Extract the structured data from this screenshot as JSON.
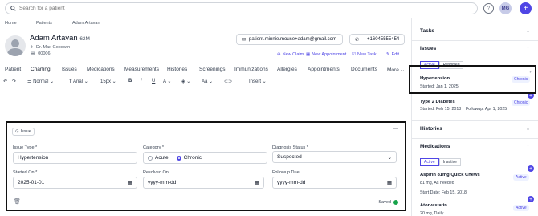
{
  "search": {
    "placeholder": "Search for a patient"
  },
  "user": {
    "initials": "MG"
  },
  "breadcrumbs": [
    "Home",
    "Patients",
    "Adam Artavan"
  ],
  "patient": {
    "name": "Adam Artavan",
    "age": "62M",
    "doctor": "Dr. Max Goodwin",
    "id": "00006",
    "email": "patient.minnie.mouse+adam@gmail.com",
    "phone": "+16045555454"
  },
  "actions": [
    "New Claim",
    "New Appointment",
    "New Task",
    "Edit"
  ],
  "tabs": [
    "Patient",
    "Charting",
    "Issues",
    "Medications",
    "Measurements",
    "Histories",
    "Screenings",
    "Immunizations",
    "Allergies",
    "Appointments",
    "Documents",
    "More"
  ],
  "toolbar": {
    "style": "Normal",
    "font": "Arial",
    "size": "15px",
    "insert": "Insert"
  },
  "issue": {
    "header": "Issue",
    "type_label": "Issue Type *",
    "type_value": "Hypertension",
    "category_label": "Category *",
    "category_options": [
      "Acute",
      "Chronic"
    ],
    "diagnosis_label": "Diagnosis Status *",
    "diagnosis_value": "Suspected",
    "started_label": "Started On *",
    "started_value": "2025-01-01",
    "resolved_label": "Resolved On",
    "resolved_placeholder": "yyyy-mm-dd",
    "followup_label": "Followup Due",
    "followup_placeholder": "yyyy-mm-dd",
    "saved": "Saved"
  },
  "sidebar": {
    "tasks": "Tasks",
    "issues": "Issues",
    "issue_tabs": [
      "Active",
      "Resolved"
    ],
    "issue_items": [
      {
        "title": "Hypertension",
        "sub": "Started: Jan 1, 2025",
        "badge": "Chronic"
      },
      {
        "title": "Type 2 Diabetes",
        "sub": "Started: Feb 15, 2018",
        "sub2": "Followup: Apr 1, 2025",
        "badge": "Chronic"
      }
    ],
    "histories": "Histories",
    "medications": "Medications",
    "med_tabs": [
      "Active",
      "Inactive"
    ],
    "med_items": [
      {
        "title": "Aspirin 81mg Quick Chews",
        "sub": "81 mg, As needed",
        "sub2": "Start Date: Feb 15, 2018",
        "badge": "Active"
      },
      {
        "title": "Atorvastatin",
        "sub": "20 mg, Daily",
        "badge": "Active"
      }
    ]
  }
}
